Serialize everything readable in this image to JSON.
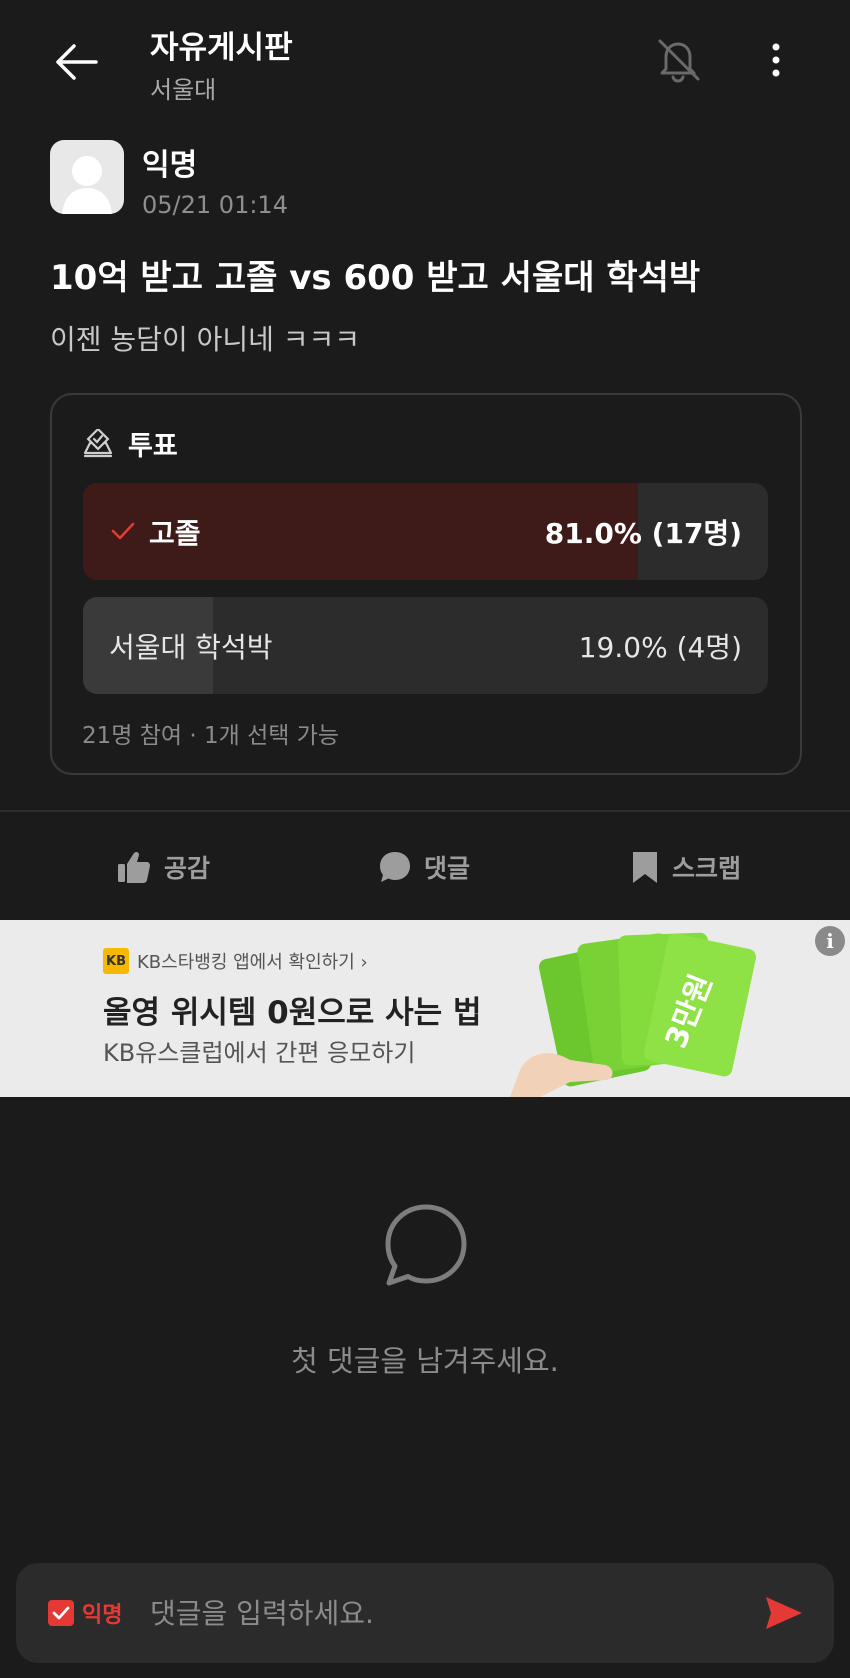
{
  "header": {
    "title": "자유게시판",
    "subtitle": "서울대"
  },
  "post": {
    "author": "익명",
    "time": "05/21 01:14",
    "title": "10억 받고 고졸 vs 600 받고 서울대 학석박",
    "body": "이젠 농담이 아니네 ㅋㅋㅋ"
  },
  "poll": {
    "title": "투표",
    "options": [
      {
        "label": "고졸",
        "result": "81.0% (17명)",
        "fraction": 0.81,
        "selected": true
      },
      {
        "label": "서울대 학석박",
        "result": "19.0% (4명)",
        "fraction": 0.19,
        "selected": false
      }
    ],
    "footer": "21명 참여 · 1개 선택 가능"
  },
  "actions": {
    "like": "공감",
    "comment": "댓글",
    "scrap": "스크랩"
  },
  "ad": {
    "top_line": "KB스타뱅킹 앱에서 확인하기 ›",
    "logo_text": "KB",
    "title": "올영 위시템 0원으로 사는 법",
    "subtitle": "KB유스클럽에서 간편 응모하기",
    "card_text": "3만원",
    "info_symbol": "i"
  },
  "comments": {
    "empty_text": "첫 댓글을 남겨주세요."
  },
  "comment_input": {
    "anon_label": "익명",
    "placeholder": "댓글을 입력하세요."
  },
  "colors": {
    "background": "#1b1b1b",
    "accent": "#e53935",
    "selected_fill": "#3e1a18",
    "unselected_fill": "#3a3a3a"
  }
}
